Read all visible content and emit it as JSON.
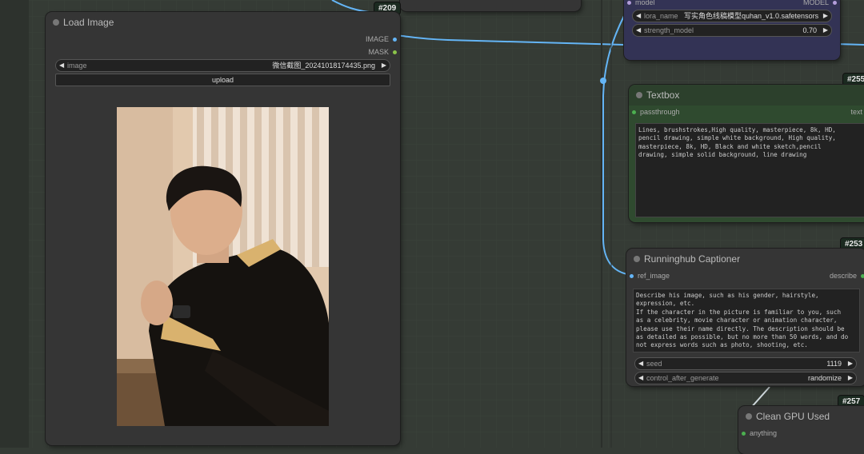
{
  "node_ids": {
    "top_partial": "#209",
    "lora_loader": "#255",
    "textbox": "#253",
    "captioner": "#257"
  },
  "load_image": {
    "title": "Load Image",
    "outputs": {
      "image": "IMAGE",
      "mask": "MASK"
    },
    "image_widget": {
      "label": "image",
      "value": "微信截图_20241018174435.png"
    },
    "upload_label": "upload",
    "preview": "portrait photo of a young man in black knit cardigan with tan trim, hands clasped, beige wall background"
  },
  "lora_loader": {
    "input_label": "model",
    "output_label": "MODEL",
    "lora_name": {
      "label": "lora_name",
      "value": "写实角色线稿模型quhan_v1.0.safetensors"
    },
    "strength_model": {
      "label": "strength_model",
      "value": "0.70"
    }
  },
  "textbox": {
    "title": "Textbox",
    "input_label": "passthrough",
    "output_label": "text",
    "text": "Lines, brushstrokes,High quality, masterpiece, 8k, HD,\npencil drawing, simple white background, High quality,\nmasterpiece, 8k, HD, Black and white sketch,pencil\ndrawing, simple solid background, line drawing"
  },
  "captioner": {
    "title": "Runninghub Captioner",
    "input_label": "ref_image",
    "output_label": "describe",
    "prompt": "Describe his image, such as his gender, hairstyle,\nexpression, etc.\nIf the character in the picture is familiar to you, such\nas a celebrity, movie character or animation character,\nplease use their name directly. The description should be\nas detailed as possible, but no more than 50 words, and do\nnot express words such as photo, shooting, etc.",
    "seed": {
      "label": "seed",
      "value": "1119"
    },
    "control_after_generate": {
      "label": "control_after_generate",
      "value": "randomize"
    }
  },
  "clean_gpu": {
    "title": "Clean GPU Used",
    "input_label": "anything"
  },
  "colors": {
    "canvas": "#353b35",
    "wire_image": "#64b5f6",
    "textbox_bg": "#2f4a2f",
    "lora_bg": "#333355"
  }
}
